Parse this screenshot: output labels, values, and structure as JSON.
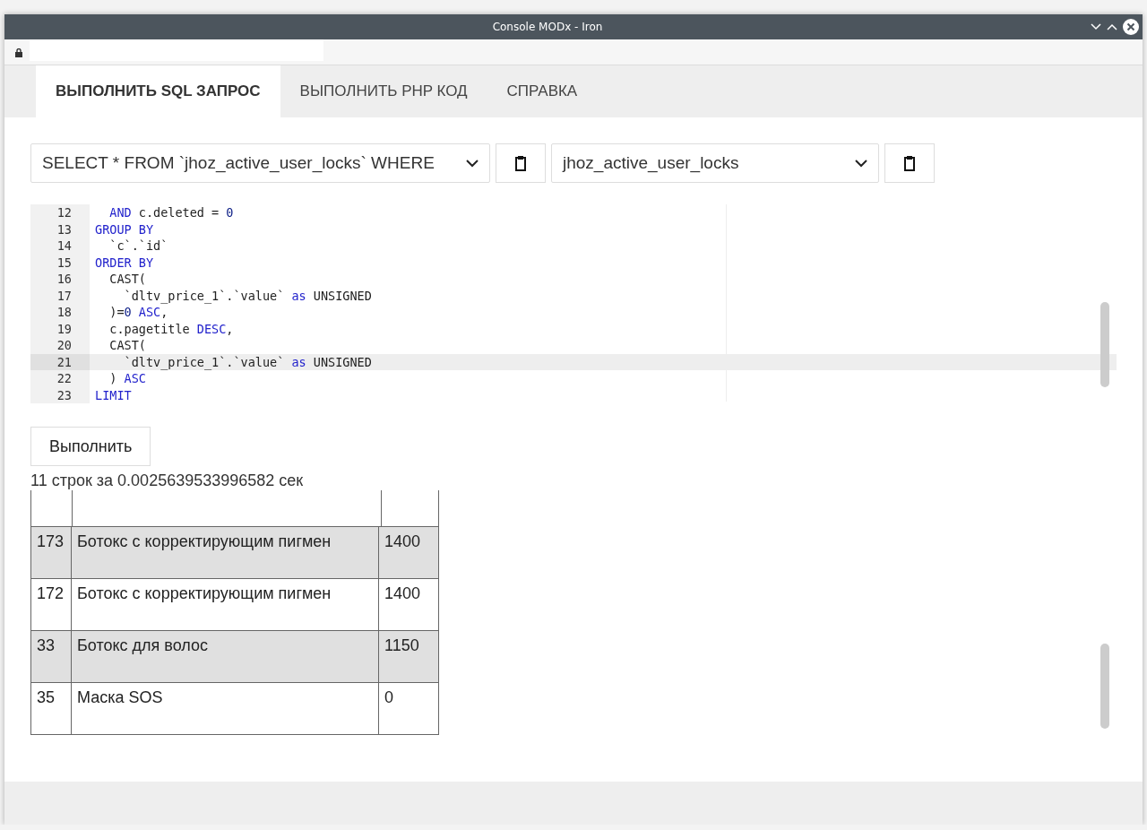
{
  "window": {
    "title": "Console MODx - Iron"
  },
  "tabs": [
    {
      "label": "ВЫПОЛНИТЬ SQL ЗАПРОС",
      "selected": true
    },
    {
      "label": "ВЫПОЛНИТЬ PHP КОД",
      "selected": false
    },
    {
      "label": "СПРАВКА",
      "selected": false
    }
  ],
  "query_select": {
    "value": "SELECT * FROM `jhoz_active_user_locks` WHERE"
  },
  "table_select": {
    "value": "jhoz_active_user_locks"
  },
  "editor": {
    "lines": [
      {
        "number": "12",
        "current": false,
        "tokens": [
          {
            "text": "  AND",
            "kind": "keyword"
          },
          {
            "text": " c.deleted = "
          },
          {
            "text": "0",
            "kind": "number"
          }
        ]
      },
      {
        "number": "13",
        "current": false,
        "tokens": [
          {
            "text": "GROUP BY",
            "kind": "keyword"
          }
        ]
      },
      {
        "number": "14",
        "current": false,
        "tokens": [
          {
            "text": "  `c`.`id`"
          }
        ]
      },
      {
        "number": "15",
        "current": false,
        "tokens": [
          {
            "text": "ORDER BY",
            "kind": "keyword"
          }
        ]
      },
      {
        "number": "16",
        "current": false,
        "tokens": [
          {
            "text": "  CAST("
          }
        ]
      },
      {
        "number": "17",
        "current": false,
        "tokens": [
          {
            "text": "    `dltv_price_1`.`value` "
          },
          {
            "text": "as",
            "kind": "keyword"
          },
          {
            "text": " UNSIGNED"
          }
        ]
      },
      {
        "number": "18",
        "current": false,
        "tokens": [
          {
            "text": "  )="
          },
          {
            "text": "0",
            "kind": "number"
          },
          {
            "text": " ASC",
            "kind": "keyword"
          },
          {
            "text": ","
          }
        ]
      },
      {
        "number": "19",
        "current": false,
        "tokens": [
          {
            "text": "  c.pagetitle "
          },
          {
            "text": "DESC",
            "kind": "keyword"
          },
          {
            "text": ","
          }
        ]
      },
      {
        "number": "20",
        "current": false,
        "tokens": [
          {
            "text": "  CAST("
          }
        ]
      },
      {
        "number": "21",
        "current": true,
        "tokens": [
          {
            "text": "    `dltv_price_1`.`value` "
          },
          {
            "text": "as",
            "kind": "keyword"
          },
          {
            "text": " UNSIGNED"
          }
        ]
      },
      {
        "number": "22",
        "current": false,
        "tokens": [
          {
            "text": "  ) "
          },
          {
            "text": "ASC",
            "kind": "keyword"
          }
        ]
      },
      {
        "number": "23",
        "current": false,
        "tokens": [
          {
            "text": "LIMIT",
            "kind": "keyword"
          }
        ]
      }
    ]
  },
  "run_button": {
    "label": "Выполнить"
  },
  "result_summary": "11 строк за 0.0025639533996582 сек",
  "results": {
    "rows": [
      {
        "cells": [
          "173",
          "Ботокс с корректирующим пигмен",
          "1400"
        ],
        "shaded": true
      },
      {
        "cells": [
          "172",
          "Ботокс с корректирующим пигмен",
          "1400"
        ],
        "shaded": false
      },
      {
        "cells": [
          "33",
          "Ботокс для волос",
          "1150"
        ],
        "shaded": true
      },
      {
        "cells": [
          "35",
          "Маска SOS",
          "0"
        ],
        "shaded": false
      }
    ]
  }
}
